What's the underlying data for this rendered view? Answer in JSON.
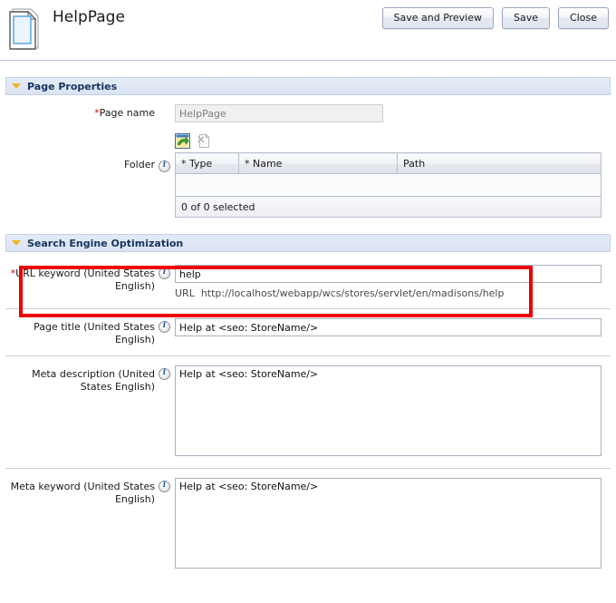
{
  "header": {
    "icon": "page-document-icon",
    "title": "HelpPage",
    "buttons": [
      {
        "label": "Save and Preview",
        "name": "save-and-preview-button"
      },
      {
        "label": "Save",
        "name": "save-button"
      },
      {
        "label": "Close",
        "name": "close-button"
      }
    ]
  },
  "sections": {
    "page_properties": {
      "title": "Page Properties",
      "page_name": {
        "label": "Page name",
        "required_marker": "*",
        "value": "HelpPage",
        "disabled": true
      },
      "folder": {
        "label": "Folder",
        "info_icon": "info-icon",
        "toolbar": [
          {
            "name": "find-and-add-icon",
            "enabled": true
          },
          {
            "name": "remove-row-icon",
            "enabled": false
          }
        ],
        "columns": [
          "* Type",
          "* Name",
          "Path"
        ],
        "rows": [],
        "status": "0 of 0 selected"
      }
    },
    "seo": {
      "title": "Search Engine Optimization",
      "url_keyword": {
        "label": "URL keyword (United States English)",
        "required_marker": "*",
        "value": "help",
        "url_label": "URL",
        "url_value": "http://localhost/webapp/wcs/stores/servlet/en/madisons/help",
        "highlighted": true
      },
      "page_title": {
        "label": "Page title (United States English)",
        "value": "Help at <seo: StoreName/>"
      },
      "meta_description": {
        "label": "Meta description (United States English)",
        "value": "Help at <seo: StoreName/>"
      },
      "meta_keyword": {
        "label": "Meta keyword (United States English)",
        "value": "Help at <seo: StoreName/>"
      }
    }
  },
  "colors": {
    "section_bar": "#dde5f3",
    "section_title": "#17335c",
    "required": "#d01010",
    "highlight": "#ee0000",
    "triangle": "#f0b429"
  }
}
